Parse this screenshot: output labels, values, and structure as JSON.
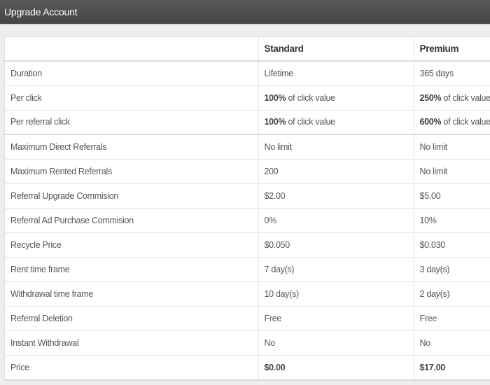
{
  "window": {
    "title": "Upgrade Account"
  },
  "table": {
    "headers": [
      "",
      "Standard",
      "Premium"
    ],
    "rows": [
      {
        "label": "Duration",
        "standard": "Lifetime",
        "premium": "365 days"
      },
      {
        "label": "Per click",
        "standard_pct": "100%",
        "standard_rest": " of click value",
        "premium_pct": "250%",
        "premium_rest": " of click value"
      },
      {
        "label": "Per referral click",
        "standard_pct": "100%",
        "standard_rest": " of click value",
        "premium_pct": "600%",
        "premium_rest": " of click value"
      },
      {
        "label": "Maximum Direct Referrals",
        "standard": "No limit",
        "premium": "No limit"
      },
      {
        "label": "Maximum Rented Referrals",
        "standard": "200",
        "premium": "No limit"
      },
      {
        "label": "Referral Upgrade Commision",
        "standard": "$2.00",
        "premium": "$5.00"
      },
      {
        "label": "Referral Ad Purchase Commision",
        "standard": "0%",
        "premium": "10%"
      },
      {
        "label": "Recycle Price",
        "standard": "$0.050",
        "premium": "$0.030"
      },
      {
        "label": "Rent time frame",
        "standard": "7 day(s)",
        "premium": "3 day(s)"
      },
      {
        "label": "Withdrawal time frame",
        "standard": "10 day(s)",
        "premium": "2 day(s)"
      },
      {
        "label": "Referral Deletion",
        "standard": "Free",
        "premium": "Free"
      },
      {
        "label": "Instant Withdrawal",
        "standard": "No",
        "premium": "No"
      },
      {
        "label": "Price",
        "standard": "$0.00",
        "premium": "$17.00"
      }
    ]
  }
}
